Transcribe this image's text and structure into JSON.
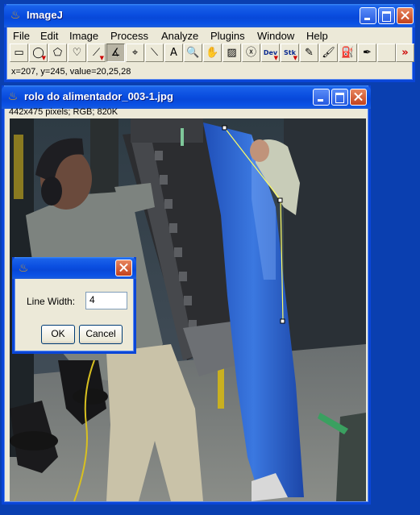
{
  "main_window": {
    "title": "ImageJ",
    "menus": [
      "File",
      "Edit",
      "Image",
      "Process",
      "Analyze",
      "Plugins",
      "Window",
      "Help"
    ],
    "tools": [
      {
        "name": "rectangle-tool-icon",
        "glyph": "▭"
      },
      {
        "name": "oval-tool-icon",
        "glyph": "◯"
      },
      {
        "name": "polygon-tool-icon",
        "glyph": "⬠"
      },
      {
        "name": "freehand-tool-icon",
        "glyph": "♡"
      },
      {
        "name": "line-tool-icon",
        "glyph": "⟋"
      },
      {
        "name": "angle-tool-icon",
        "glyph": "∡"
      },
      {
        "name": "point-tool-icon",
        "glyph": "⌖"
      },
      {
        "name": "wand-tool-icon",
        "glyph": "⟍"
      },
      {
        "name": "text-tool-icon",
        "glyph": "A"
      },
      {
        "name": "magnifier-tool-icon",
        "glyph": "🔍"
      },
      {
        "name": "hand-tool-icon",
        "glyph": "✋"
      },
      {
        "name": "color-picker-tool-icon",
        "glyph": "▨"
      },
      {
        "name": "stop-tool-icon",
        "glyph": "ⓧ"
      },
      {
        "name": "dev-tool-icon",
        "glyph": "Dev"
      },
      {
        "name": "stk-tool-icon",
        "glyph": "Stk"
      },
      {
        "name": "pencil-tool-icon",
        "glyph": "✎"
      },
      {
        "name": "brush-tool-icon",
        "glyph": "🖌"
      },
      {
        "name": "flood-fill-tool-icon",
        "glyph": "⛽"
      },
      {
        "name": "dropper-tool-icon",
        "glyph": "✒"
      },
      {
        "name": "empty-tool-slot",
        "glyph": ""
      },
      {
        "name": "more-tools-icon",
        "glyph": "»"
      }
    ],
    "status": "x=207, y=245, value=20,25,28"
  },
  "image_window": {
    "title": "rolo do alimentador_003-1.jpg",
    "info": "442x475 pixels; RGB; 820K"
  },
  "dialog": {
    "label": "Line Width:",
    "value": "4",
    "ok_label": "OK",
    "cancel_label": "Cancel"
  },
  "colors": {
    "xp_title": "#0a4ee0",
    "window_bg": "#ece9d8",
    "desktop": "#0a3fb0",
    "selection_line": "#ffff66"
  }
}
